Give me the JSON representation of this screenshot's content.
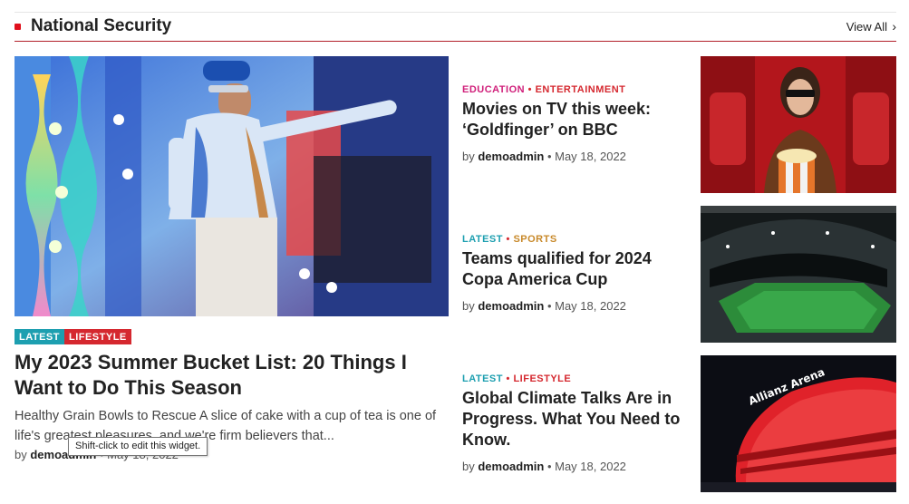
{
  "section": {
    "title": "National Security",
    "view_all": "View All"
  },
  "featured": {
    "tags": [
      "LATEST",
      "LIFESTYLE"
    ],
    "title": "My 2023 Summer Bucket List: 20 Things I Want to Do This Season",
    "excerpt": "Healthy Grain Bowls to Rescue A slice of cake with a cup of tea is one of life's greatest pleasures, and we're firm believers that...",
    "meta_by": "by",
    "author": "demoadmin",
    "date": "May 18, 2022"
  },
  "tooltip": "Shift-click to edit this widget.",
  "articles": [
    {
      "categories": [
        "EDUCATION",
        "ENTERTAINMENT"
      ],
      "title": "Movies on TV this week: ‘Goldfinger’ on BBC",
      "meta_by": "by",
      "author": "demoadmin",
      "date": "May 18, 2022"
    },
    {
      "categories": [
        "LATEST",
        "SPORTS"
      ],
      "title": "Teams qualified for 2024 Copa America Cup",
      "meta_by": "by",
      "author": "demoadmin",
      "date": "May 18, 2022"
    },
    {
      "categories": [
        "LATEST",
        "LIFESTYLE"
      ],
      "title": "Global Climate Talks Are in Progress. What You Need to Know.",
      "meta_by": "by",
      "author": "demoadmin",
      "date": "May 18, 2022"
    }
  ],
  "images": {
    "stadium_sign": "Allianz Arena"
  },
  "colors": {
    "accent_red": "#d5282f",
    "latest_teal": "#1d9fb0",
    "education_pink": "#d01f7a",
    "sports_gold": "#c8892a"
  }
}
